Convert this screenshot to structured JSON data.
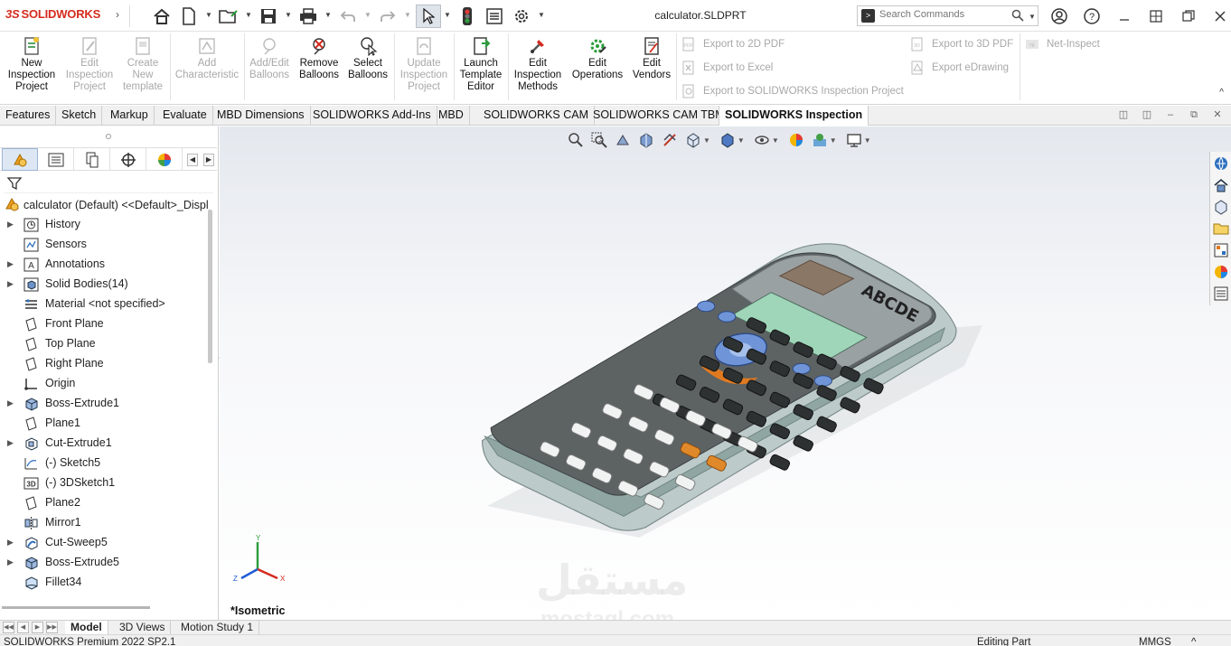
{
  "app": {
    "brand": "SOLIDWORKS",
    "document_title": "calculator.SLDPRT"
  },
  "search": {
    "placeholder": "Search Commands"
  },
  "ribbon": {
    "buttons": [
      {
        "label": "New Inspection Project",
        "lines": [
          "New",
          "Inspection",
          "Project"
        ],
        "enabled": true
      },
      {
        "label": "Edit Inspection Project",
        "lines": [
          "Edit",
          "Inspection",
          "Project"
        ],
        "enabled": false
      },
      {
        "label": "Create New template",
        "lines": [
          "Create",
          "New",
          "template"
        ],
        "enabled": false
      },
      {
        "label": "Add Characteristic",
        "lines": [
          "Add",
          "Characteristic"
        ],
        "enabled": false
      },
      {
        "label": "Add/Edit Balloons",
        "lines": [
          "Add/Edit",
          "Balloons"
        ],
        "enabled": false
      },
      {
        "label": "Remove Balloons",
        "lines": [
          "Remove",
          "Balloons"
        ],
        "enabled": true
      },
      {
        "label": "Select Balloons",
        "lines": [
          "Select",
          "Balloons"
        ],
        "enabled": true
      },
      {
        "label": "Update Inspection Project",
        "lines": [
          "Update",
          "Inspection",
          "Project"
        ],
        "enabled": false
      },
      {
        "label": "Launch Template Editor",
        "lines": [
          "Launch",
          "Template",
          "Editor"
        ],
        "enabled": true
      },
      {
        "label": "Edit Inspection Methods",
        "lines": [
          "Edit",
          "Inspection",
          "Methods"
        ],
        "enabled": true
      },
      {
        "label": "Edit Operations",
        "lines": [
          "Edit",
          "Operations"
        ],
        "enabled": true
      },
      {
        "label": "Edit Vendors",
        "lines": [
          "Edit",
          "Vendors"
        ],
        "enabled": true
      }
    ],
    "export_2d_pdf": "Export to 2D PDF",
    "export_excel": "Export to Excel",
    "export_sw_project": "Export to SOLIDWORKS Inspection Project",
    "export_3d_pdf": "Export to 3D PDF",
    "export_edrawing": "Export eDrawing",
    "net_inspect": "Net-Inspect"
  },
  "tabs": [
    "Features",
    "Sketch",
    "Markup",
    "Evaluate",
    "MBD Dimensions",
    "SOLIDWORKS Add-Ins",
    "MBD",
    "SOLIDWORKS CAM",
    "SOLIDWORKS CAM TBM",
    "SOLIDWORKS Inspection"
  ],
  "active_tab": "SOLIDWORKS Inspection",
  "tree": {
    "root": "calculator (Default) <<Default>_Displ",
    "items": [
      {
        "label": "History",
        "icon": "history-icon",
        "expandable": true
      },
      {
        "label": "Sensors",
        "icon": "sensors-icon",
        "expandable": false
      },
      {
        "label": "Annotations",
        "icon": "annotations-icon",
        "expandable": true
      },
      {
        "label": "Solid Bodies(14)",
        "icon": "solid-bodies-icon",
        "expandable": true
      },
      {
        "label": "Material <not specified>",
        "icon": "material-icon",
        "expandable": false
      },
      {
        "label": "Front Plane",
        "icon": "plane-icon",
        "expandable": false
      },
      {
        "label": "Top Plane",
        "icon": "plane-icon",
        "expandable": false
      },
      {
        "label": "Right Plane",
        "icon": "plane-icon",
        "expandable": false
      },
      {
        "label": "Origin",
        "icon": "origin-icon",
        "expandable": false
      },
      {
        "label": "Boss-Extrude1",
        "icon": "boss-extrude-icon",
        "expandable": true
      },
      {
        "label": "Plane1",
        "icon": "plane-icon",
        "expandable": false
      },
      {
        "label": "Cut-Extrude1",
        "icon": "cut-extrude-icon",
        "expandable": true
      },
      {
        "label": "(-) Sketch5",
        "icon": "sketch-icon",
        "expandable": false
      },
      {
        "label": "(-) 3DSketch1",
        "icon": "3dsketch-icon",
        "expandable": false
      },
      {
        "label": "Plane2",
        "icon": "plane-icon",
        "expandable": false
      },
      {
        "label": "Mirror1",
        "icon": "mirror-icon",
        "expandable": false
      },
      {
        "label": "Cut-Sweep5",
        "icon": "cut-sweep-icon",
        "expandable": true
      },
      {
        "label": "Boss-Extrude5",
        "icon": "boss-extrude-icon",
        "expandable": true
      },
      {
        "label": "Fillet34",
        "icon": "fillet-icon",
        "expandable": false
      }
    ]
  },
  "viewport": {
    "view_label": "*Isometric",
    "model_display_text": "ABCDE",
    "triad": {
      "x": "X",
      "y": "Y",
      "z": "Z"
    }
  },
  "watermark": {
    "arabic": "مستقل",
    "latin": "mostaql.com"
  },
  "bottom_tabs": [
    "Model",
    "3D Views",
    "Motion Study 1"
  ],
  "active_bottom_tab": "Model",
  "status": {
    "product": "SOLIDWORKS Premium 2022 SP2.1",
    "mode": "Editing Part",
    "units": "MMGS"
  },
  "colors": {
    "brand_red": "#d52b1e",
    "calc_screen": "#9fd6b9",
    "calc_body": "#5a5f60",
    "calc_frame": "#b8c4c4",
    "key_blue": "#6f95d8",
    "key_orange": "#e07a20"
  }
}
